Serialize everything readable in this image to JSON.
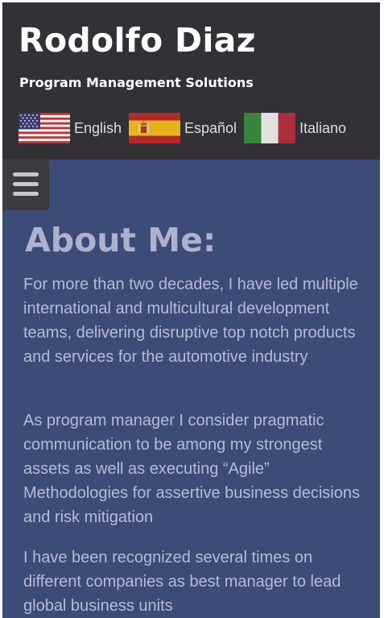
{
  "header": {
    "title": "Rodolfo Diaz",
    "subtitle": "Program Management Solutions"
  },
  "languages": [
    {
      "label": "English",
      "flag": "us-flag-icon"
    },
    {
      "label": "Español",
      "flag": "spain-flag-icon"
    },
    {
      "label": "Italiano",
      "flag": "italy-flag-icon"
    }
  ],
  "menu": {
    "icon": "hamburger-menu-icon"
  },
  "about": {
    "heading": "About Me:",
    "paragraphs": [
      "For more than two decades, I have led multiple international and multicultural development teams, delivering disruptive top notch products and services for the automotive industry",
      "As program manager I consider pragmatic communication to be among my strongest assets as well as executing “Agile” Methodologies for assertive business decisions and risk mitigation",
      "I have been recognized several times on different companies as best manager to lead global business units"
    ]
  },
  "colors": {
    "header_bg": "#333036",
    "page_bg": "#3d4b79",
    "heading": "#b0b1cf",
    "body_text": "#b8b9d6"
  }
}
